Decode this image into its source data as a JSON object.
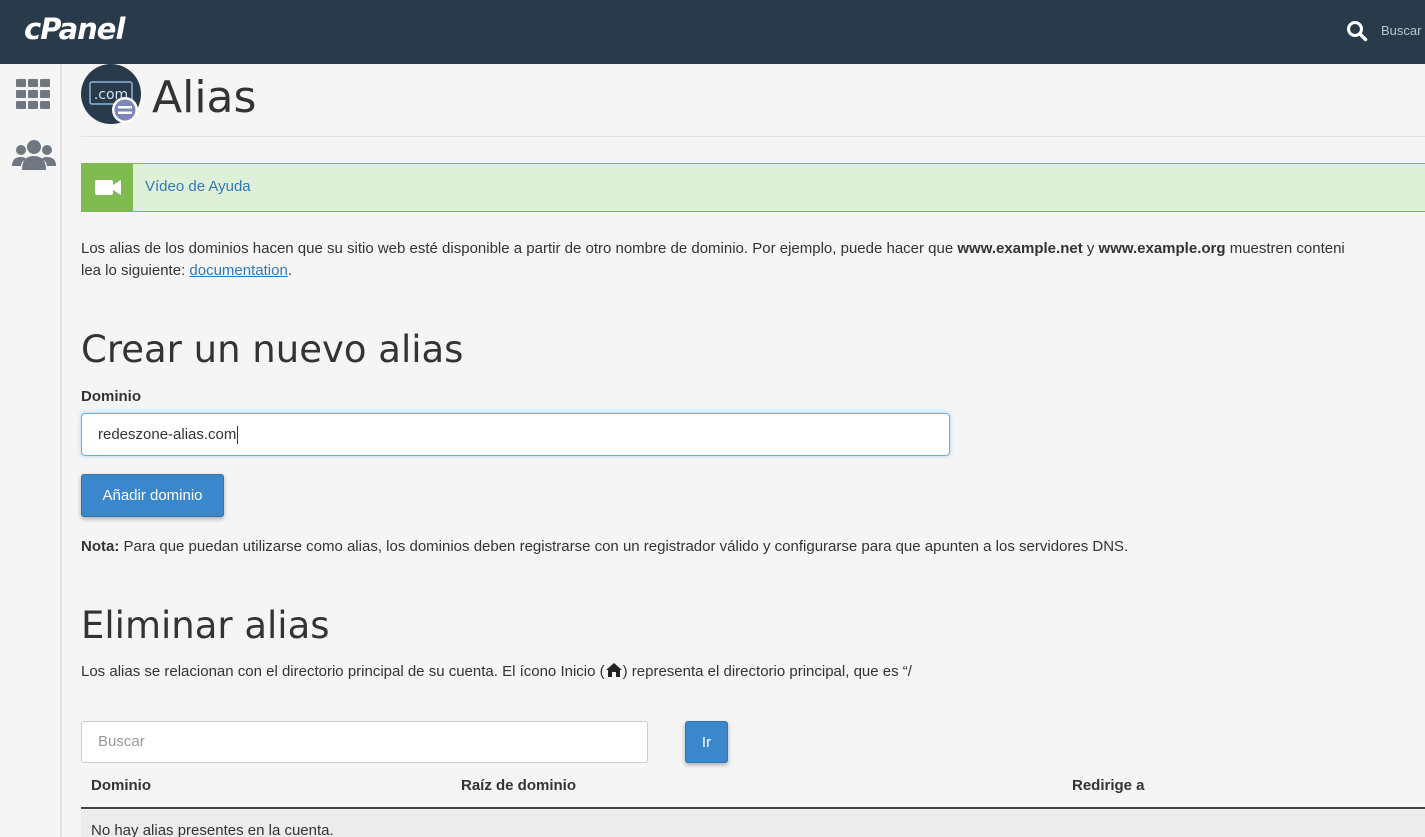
{
  "topbar": {
    "logo": "cPanel",
    "search_label": "Buscar",
    "search_icon": "search-icon"
  },
  "sidebar": {
    "icons": [
      "grid-icon",
      "users-icon"
    ]
  },
  "page": {
    "title": "Alias",
    "icon": "domain-alias-icon"
  },
  "help": {
    "icon": "video-camera-icon",
    "link_label": "Vídeo de Ayuda"
  },
  "description": {
    "text_1": "Los alias de los dominios hacen que su sitio web esté disponible a partir de otro nombre de dominio. Por ejemplo, puede hacer que ",
    "example_1": "www.example.net",
    "text_2": " y ",
    "example_2": "www.example.org",
    "text_3": " muestren conteni",
    "text_4": "lea lo siguiente: ",
    "doc_link": "documentation",
    "text_5": "."
  },
  "create": {
    "heading": "Crear un nuevo alias",
    "domain_label": "Dominio",
    "domain_value": "redeszone-alias.com",
    "add_button": "Añadir dominio",
    "note_label": "Nota:",
    "note_text": " Para que puedan utilizarse como alias, los dominios deben registrarse con un registrador válido y configurarse para que apunten a los servidores DNS."
  },
  "remove": {
    "heading": "Eliminar alias",
    "desc_1": "Los alias se relacionan con el directorio principal de su cuenta. El ícono Inicio (",
    "desc_2": ") representa el directorio principal, que es “/",
    "home_icon": "home-icon",
    "search_placeholder": "Buscar",
    "go_button": "Ir"
  },
  "table": {
    "columns": [
      "Dominio",
      "Raíz de dominio",
      "Redirige a"
    ],
    "empty_message": "No hay alias presentes en la cuenta."
  },
  "colors": {
    "topbar": "#293a4a",
    "primary": "#3a87cc",
    "help_bg": "#dff0d8",
    "help_accent": "#80bb52",
    "link": "#2f7ab8"
  }
}
